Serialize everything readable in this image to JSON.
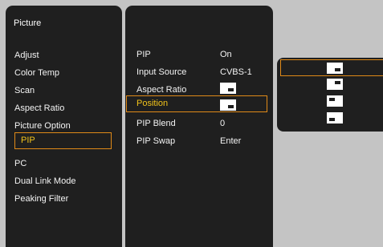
{
  "sidebar": {
    "title": "Picture",
    "items": [
      {
        "label": "Adjust"
      },
      {
        "label": "Color Temp"
      },
      {
        "label": "Scan"
      },
      {
        "label": "Aspect Ratio"
      },
      {
        "label": "Picture Option"
      },
      {
        "label": "PIP"
      },
      {
        "label": "PC"
      },
      {
        "label": "Dual Link Mode"
      },
      {
        "label": "Peaking Filter"
      }
    ],
    "selected_index": 5
  },
  "submenu": {
    "rows": [
      {
        "label": "PIP",
        "value": "On"
      },
      {
        "label": "Input Source",
        "value": "CVBS-1"
      },
      {
        "label": "Aspect Ratio",
        "value": "",
        "icon": "aspect-ratio-icon"
      },
      {
        "label": "Position",
        "value": "",
        "icon": "pip-bottom-right-icon"
      },
      {
        "label": "PIP Blend",
        "value": "0"
      },
      {
        "label": "PIP Swap",
        "value": "Enter"
      }
    ],
    "selected_index": 3
  },
  "position_options": {
    "options": [
      {
        "icon": "pip-bottom-right-icon"
      },
      {
        "icon": "pip-top-right-icon"
      },
      {
        "icon": "pip-top-left-icon"
      },
      {
        "icon": "pip-bottom-left-icon"
      }
    ],
    "selected_index": 0
  },
  "colors": {
    "accent_border": "#e08a18",
    "selected_text": "#f1c21b",
    "panel_bg": "#1f1f1f",
    "page_bg": "#c4c4c4"
  }
}
